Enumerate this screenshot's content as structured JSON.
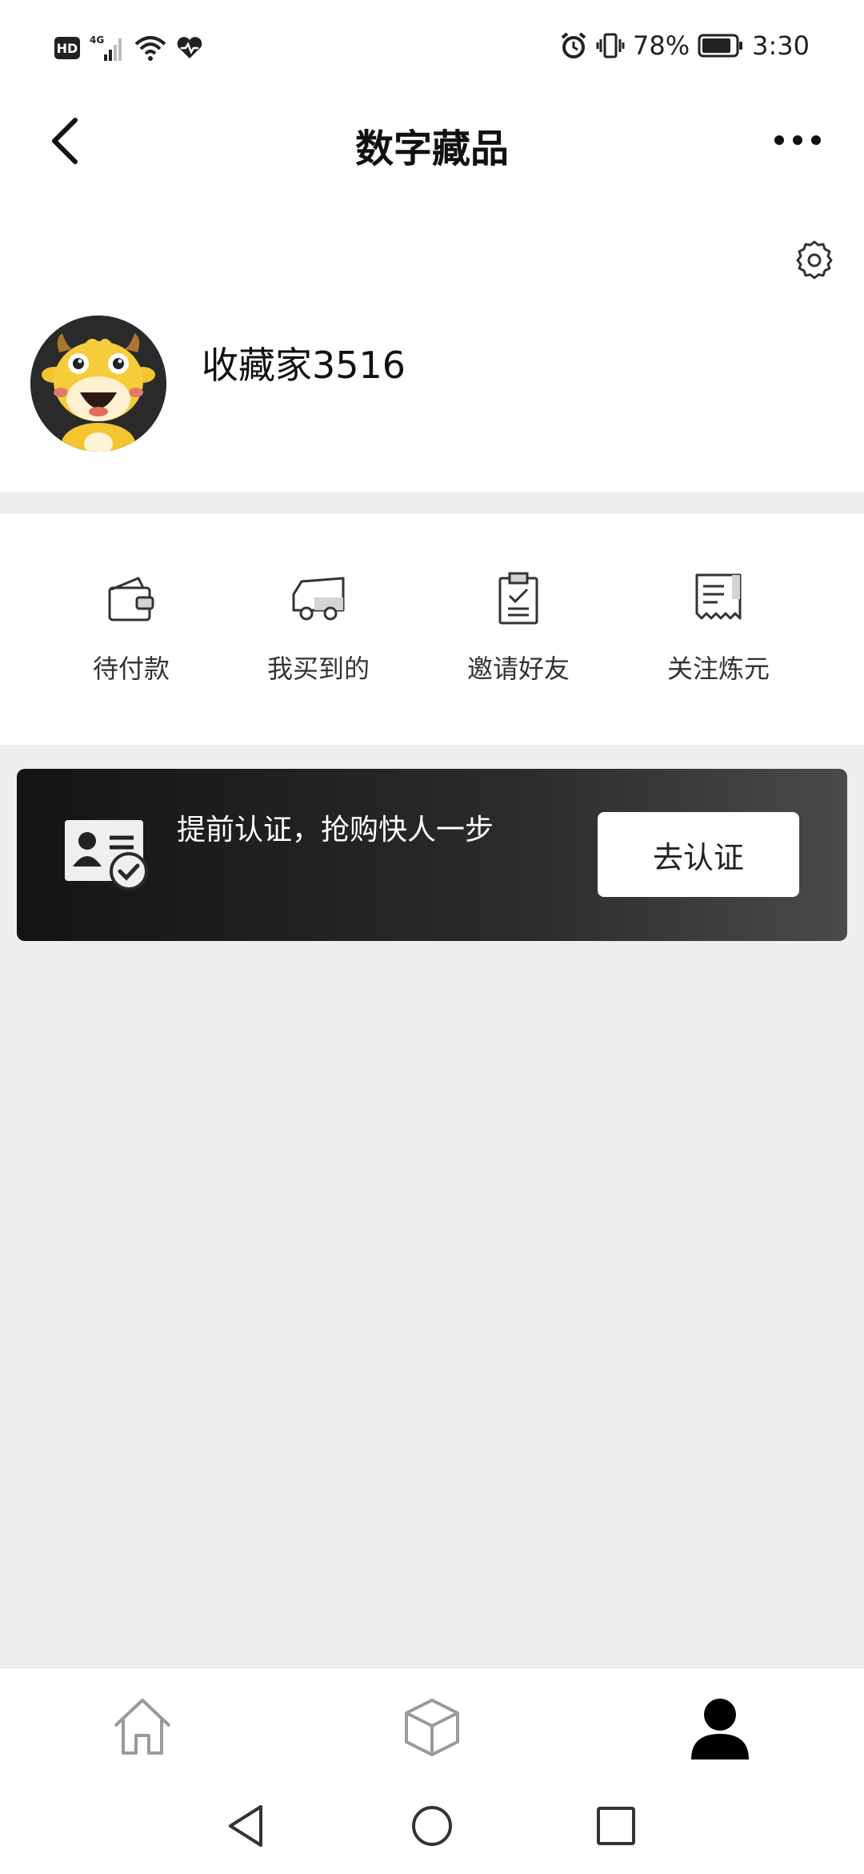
{
  "status_bar": {
    "hd": "HD",
    "network": "4G",
    "battery": "78%",
    "time": "3:30",
    "icons": [
      "hd-badge-icon",
      "signal-icon",
      "wifi-icon",
      "heart-rate-icon",
      "alarm-icon",
      "vibrate-icon",
      "battery-icon"
    ]
  },
  "nav": {
    "title": "数字藏品",
    "back_icon": "chevron-left-icon",
    "more_icon": "more-dots-icon"
  },
  "profile": {
    "username": "收藏家3516",
    "settings_icon": "gear-icon",
    "avatar_icon": "cow-mascot-avatar"
  },
  "actions": [
    {
      "label": "待付款",
      "icon": "wallet-icon"
    },
    {
      "label": "我买到的",
      "icon": "truck-icon"
    },
    {
      "label": "邀请好友",
      "icon": "clipboard-check-icon"
    },
    {
      "label": "关注炼元",
      "icon": "receipt-icon"
    }
  ],
  "banner": {
    "text": "提前认证，抢购快人一步",
    "button": "去认证",
    "icon": "id-card-check-icon"
  },
  "tabs": [
    {
      "icon": "home-icon",
      "active": false
    },
    {
      "icon": "cube-icon",
      "active": false
    },
    {
      "icon": "person-icon",
      "active": true
    }
  ],
  "system_nav": [
    "back-triangle-icon",
    "home-circle-icon",
    "recents-square-icon"
  ],
  "colors": {
    "page_bg": "#eeeeee",
    "card_bg": "#ffffff",
    "banner_start": "#141414",
    "banner_end": "#4a4a4a",
    "text_primary": "#111111",
    "icon_inactive": "#9a9a9a"
  }
}
